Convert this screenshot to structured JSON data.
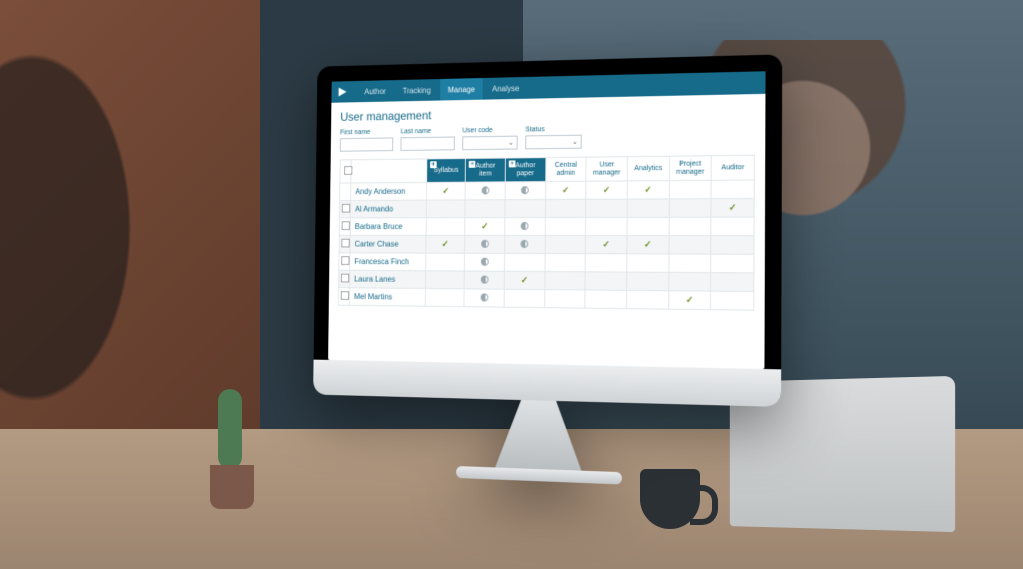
{
  "nav": {
    "items": [
      {
        "label": "Author",
        "active": false
      },
      {
        "label": "Tracking",
        "active": false
      },
      {
        "label": "Manage",
        "active": true
      },
      {
        "label": "Analyse",
        "active": false
      }
    ]
  },
  "page": {
    "title": "User management"
  },
  "filters": {
    "first_name": {
      "label": "First name",
      "value": ""
    },
    "last_name": {
      "label": "Last name",
      "value": ""
    },
    "user_code": {
      "label": "User code",
      "value": ""
    },
    "status": {
      "label": "Status",
      "value": ""
    }
  },
  "columns": {
    "syllabus": "Syllabus",
    "author_item_1": "Author",
    "author_item_2": "item",
    "author_paper_1": "Author",
    "author_paper_2": "paper",
    "central_admin_1": "Central",
    "central_admin_2": "admin",
    "user_manager_1": "User",
    "user_manager_2": "manager",
    "analytics": "Analytics",
    "project_manager_1": "Project",
    "project_manager_2": "manager",
    "auditor": "Auditor"
  },
  "users": [
    {
      "name": "Andy Anderson",
      "syllabus": "check",
      "author_item": "half",
      "author_paper": "half",
      "central_admin": "check",
      "user_manager": "check",
      "analytics": "check",
      "project_manager": "",
      "auditor": ""
    },
    {
      "name": "Al Armando",
      "syllabus": "",
      "author_item": "",
      "author_paper": "",
      "central_admin": "",
      "user_manager": "",
      "analytics": "",
      "project_manager": "",
      "auditor": "check"
    },
    {
      "name": "Barbara Bruce",
      "syllabus": "",
      "author_item": "check",
      "author_paper": "half",
      "central_admin": "",
      "user_manager": "",
      "analytics": "",
      "project_manager": "",
      "auditor": ""
    },
    {
      "name": "Carter Chase",
      "syllabus": "check",
      "author_item": "half",
      "author_paper": "half",
      "central_admin": "",
      "user_manager": "check",
      "analytics": "check",
      "project_manager": "",
      "auditor": ""
    },
    {
      "name": "Francesca Finch",
      "syllabus": "",
      "author_item": "half",
      "author_paper": "",
      "central_admin": "",
      "user_manager": "",
      "analytics": "",
      "project_manager": "",
      "auditor": ""
    },
    {
      "name": "Laura Lanes",
      "syllabus": "",
      "author_item": "half",
      "author_paper": "check",
      "central_admin": "",
      "user_manager": "",
      "analytics": "",
      "project_manager": "",
      "auditor": ""
    },
    {
      "name": "Mel Martins",
      "syllabus": "",
      "author_item": "half",
      "author_paper": "",
      "central_admin": "",
      "user_manager": "",
      "analytics": "",
      "project_manager": "check",
      "auditor": ""
    }
  ]
}
